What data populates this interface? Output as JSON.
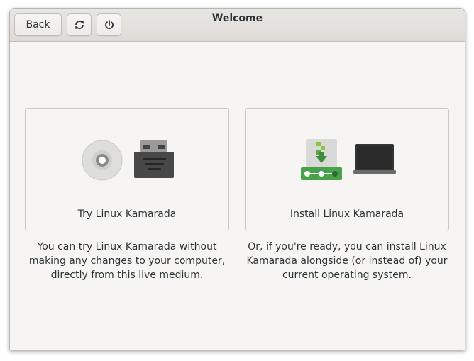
{
  "window": {
    "title": "Welcome"
  },
  "header": {
    "back_label": "Back",
    "reload_icon": "reload-icon",
    "power_icon": "power-icon"
  },
  "options": {
    "try": {
      "label": "Try Linux Kamarada",
      "description": "You can try Linux Kamarada without making any changes to your computer, directly from this live medium.",
      "icons": [
        "cd-icon",
        "usb-drive-icon"
      ]
    },
    "install": {
      "label": "Install Linux Kamarada",
      "description": "Or, if you're ready, you can install Linux Kamarada alongside (or instead of) your current operating system.",
      "icons": [
        "install-download-icon",
        "laptop-icon"
      ]
    }
  },
  "colors": {
    "install_green": "#4aa54a",
    "install_green_light": "#73d216"
  }
}
